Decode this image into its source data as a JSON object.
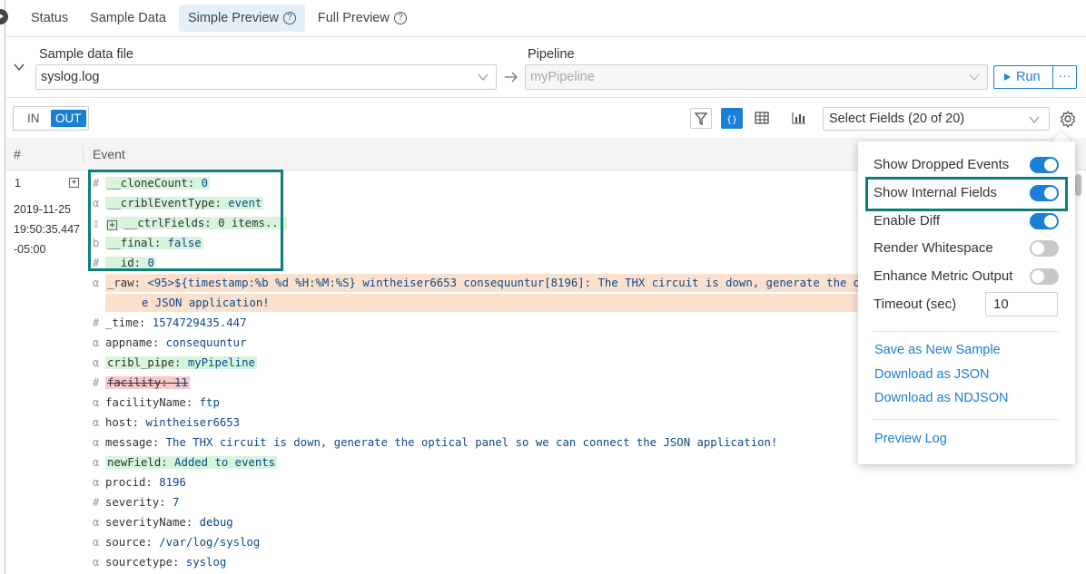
{
  "tabs": [
    {
      "label": "Status"
    },
    {
      "label": "Sample Data"
    },
    {
      "label": "Simple Preview"
    },
    {
      "label": "Full Preview"
    }
  ],
  "sample": {
    "label": "Sample data file",
    "value": "syslog.log"
  },
  "pipeline": {
    "label": "Pipeline",
    "value": "myPipeline"
  },
  "run_label": "Run",
  "more_label": "···",
  "inout": {
    "in": "IN",
    "out": "OUT"
  },
  "fields_select": "Select Fields (20 of 20)",
  "grid": {
    "col_num": "#",
    "col_event": "Event"
  },
  "row": {
    "num": "1",
    "expander": "+",
    "date": "2019-11-25",
    "time": "19:50:35.447",
    "tz": "-05:00"
  },
  "fields": [
    {
      "type": "#",
      "key": "__cloneCount:",
      "value": "0"
    },
    {
      "type": "α",
      "key": "__criblEventType:",
      "value": "event"
    },
    {
      "type": "▯",
      "key": "__ctrlFields:",
      "value": "0 items..."
    },
    {
      "type": "b",
      "key": "__final:",
      "value": "false"
    },
    {
      "type": "#",
      "key": "__id:",
      "value": "0"
    },
    {
      "type": "α",
      "key": "_raw:",
      "value": "<95>${timestamp:%b %d %H:%M:%S} wintheiser6653 consequuntur[8196]: The THX circuit is down, generate the opti",
      "value2": "e JSON application!"
    },
    {
      "type": "#",
      "key": "_time:",
      "value": "1574729435.447"
    },
    {
      "type": "α",
      "key": "appname:",
      "value": "consequuntur"
    },
    {
      "type": "α",
      "key": "cribl_pipe:",
      "value": "myPipeline"
    },
    {
      "type": "#",
      "key": "facility:",
      "value": "11"
    },
    {
      "type": "α",
      "key": "facilityName:",
      "value": "ftp"
    },
    {
      "type": "α",
      "key": "host:",
      "value": "wintheiser6653"
    },
    {
      "type": "α",
      "key": "message:",
      "value": "The THX circuit is down, generate the optical panel so we can connect the JSON application!"
    },
    {
      "type": "α",
      "key": "newField:",
      "value": "Added to events"
    },
    {
      "type": "α",
      "key": "procid:",
      "value": "8196"
    },
    {
      "type": "#",
      "key": "severity:",
      "value": "7"
    },
    {
      "type": "α",
      "key": "severityName:",
      "value": "debug"
    },
    {
      "type": "α",
      "key": "source:",
      "value": "/var/log/syslog"
    },
    {
      "type": "α",
      "key": "sourcetype:",
      "value": "syslog"
    }
  ],
  "settings": {
    "options": [
      {
        "label": "Show Dropped Events",
        "state": "on"
      },
      {
        "label": "Show Internal Fields",
        "state": "on"
      },
      {
        "label": "Enable Diff",
        "state": "on"
      },
      {
        "label": "Render Whitespace",
        "state": "off"
      },
      {
        "label": "Enhance Metric Output",
        "state": "off"
      }
    ],
    "timeout_label": "Timeout (sec)",
    "timeout_value": "10",
    "links": [
      "Save as New Sample",
      "Download as JSON",
      "Download as NDJSON"
    ],
    "preview_log": "Preview Log"
  },
  "colors": {
    "accent": "#1a7fd6",
    "highlight_box": "#0d7f79",
    "added": "#d6f5dc",
    "removed": "#f9c9ca",
    "modified": "#fbe0cd"
  }
}
